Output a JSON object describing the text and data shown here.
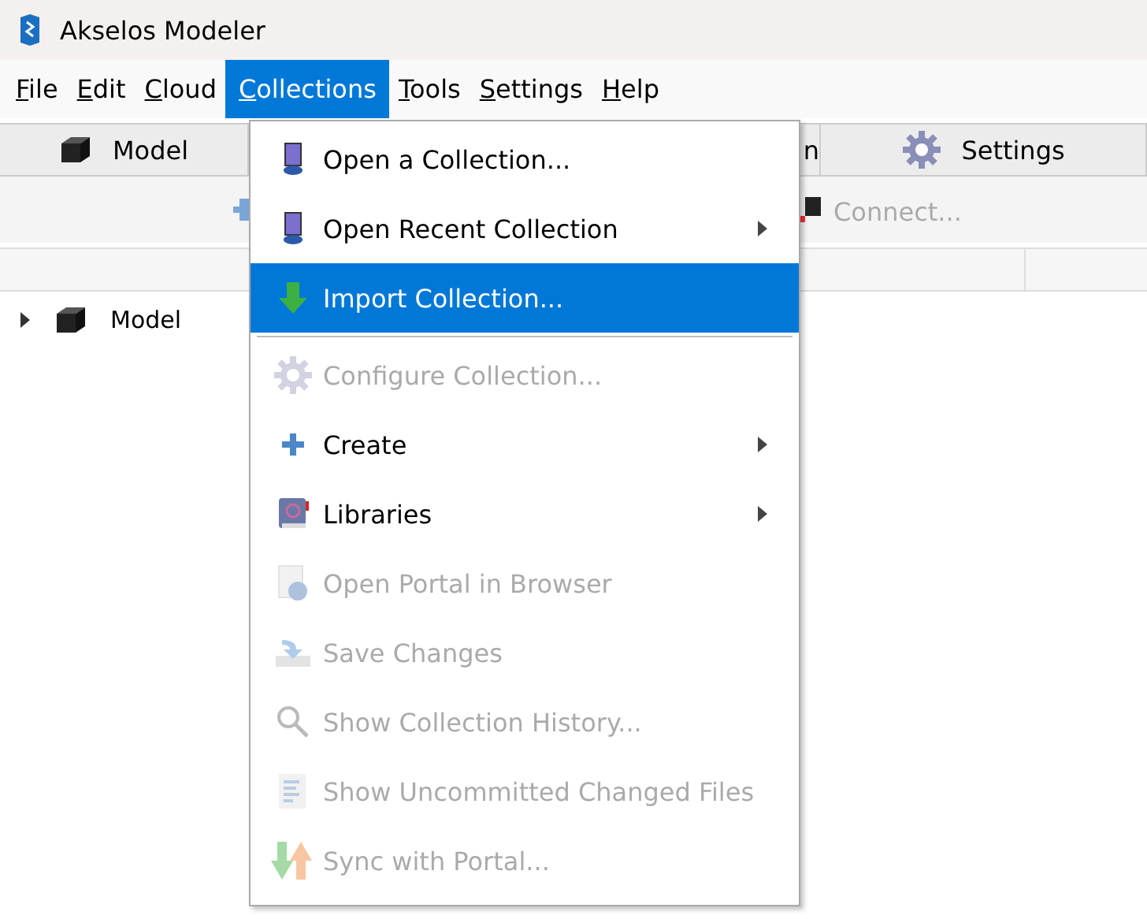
{
  "window": {
    "title": "Akselos Modeler"
  },
  "menu_bar": [
    {
      "label": "File",
      "selected": false
    },
    {
      "label": "Edit",
      "selected": false
    },
    {
      "label": "Cloud",
      "selected": false
    },
    {
      "label": "Collections",
      "selected": true
    },
    {
      "label": "Tools",
      "selected": false
    },
    {
      "label": "Settings",
      "selected": false
    },
    {
      "label": "Help",
      "selected": false
    }
  ],
  "tabs": [
    {
      "label": "Model",
      "selected": false
    },
    {
      "label": "n",
      "selected": false
    },
    {
      "label": "Settings",
      "selected": false
    }
  ],
  "toolbar": {
    "connect": {
      "label": "Connect...",
      "disabled": true
    }
  },
  "tree": [
    {
      "label": "Model",
      "expanded": false
    }
  ],
  "menu": [
    {
      "label": "Open a Collection...",
      "disabled": false,
      "selected": false,
      "submenu": false
    },
    {
      "label": "Open Recent Collection",
      "disabled": false,
      "selected": false,
      "submenu": true
    },
    {
      "label": "Import Collection...",
      "disabled": false,
      "selected": true,
      "submenu": false,
      "separator_after": true
    },
    {
      "label": "Configure Collection...",
      "disabled": true,
      "selected": false,
      "submenu": false
    },
    {
      "label": "Create",
      "disabled": false,
      "selected": false,
      "submenu": true
    },
    {
      "label": "Libraries",
      "disabled": false,
      "selected": false,
      "submenu": true
    },
    {
      "label": "Open Portal in Browser",
      "disabled": true,
      "selected": false,
      "submenu": false
    },
    {
      "label": "Save Changes",
      "disabled": true,
      "selected": false,
      "submenu": false
    },
    {
      "label": "Show Collection History...",
      "disabled": true,
      "selected": false,
      "submenu": false
    },
    {
      "label": "Show Uncommitted Changed Files",
      "disabled": true,
      "selected": false,
      "submenu": false
    },
    {
      "label": "Sync with Portal...",
      "disabled": true,
      "selected": false,
      "submenu": false
    }
  ]
}
